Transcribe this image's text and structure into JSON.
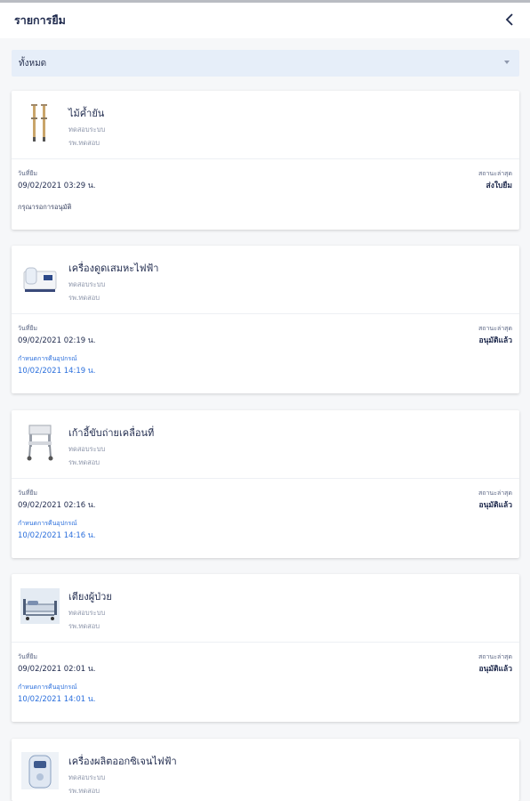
{
  "header": {
    "title": "รายการยืม",
    "back_icon": "chevron-left-icon"
  },
  "filter": {
    "selected": "ทั้งหมด",
    "icon": "caret-down-icon"
  },
  "labels": {
    "borrow_date": "วันที่ยืม",
    "latest_status": "สถานะล่าสุด",
    "return_due": "กำหนดการคืนอุปกรณ์"
  },
  "items": [
    {
      "name": "ไม้ค้ำยัน",
      "sub1": "ทดสอบระบบ",
      "sub2": "รพ.ทดสอบ",
      "borrow_date": "09/02/2021 03:29 น.",
      "status": "ส่งใบยืม",
      "note": "กรุณารอการอนุมัติ",
      "icon": "crutches-icon"
    },
    {
      "name": "เครื่องดูดเสมหะไฟฟ้า",
      "sub1": "ทดสอบระบบ",
      "sub2": "รพ.ทดสอบ",
      "borrow_date": "09/02/2021 02:19 น.",
      "status": "อนุมัติแล้ว",
      "return_due": "10/02/2021 14:19 น.",
      "icon": "suction-machine-icon"
    },
    {
      "name": "เก้าอี้ขับถ่ายเคลื่อนที่",
      "sub1": "ทดสอบระบบ",
      "sub2": "รพ.ทดสอบ",
      "borrow_date": "09/02/2021 02:16 น.",
      "status": "อนุมัติแล้ว",
      "return_due": "10/02/2021 14:16 น.",
      "icon": "commode-chair-icon"
    },
    {
      "name": "เตียงผู้ป่วย",
      "sub1": "ทดสอบระบบ",
      "sub2": "รพ.ทดสอบ",
      "borrow_date": "09/02/2021 02:01 น.",
      "status": "อนุมัติแล้ว",
      "return_due": "10/02/2021 14:01 น.",
      "icon": "hospital-bed-icon"
    },
    {
      "name": "เครื่องผลิตออกซิเจนไฟฟ้า",
      "sub1": "ทดสอบระบบ",
      "sub2": "รพ.ทดสอบ",
      "icon": "oxygen-concentrator-icon"
    }
  ],
  "colors": {
    "accent": "#2b6fdc",
    "text": "#1f2a4d",
    "filter_bg": "#e6eef9"
  }
}
